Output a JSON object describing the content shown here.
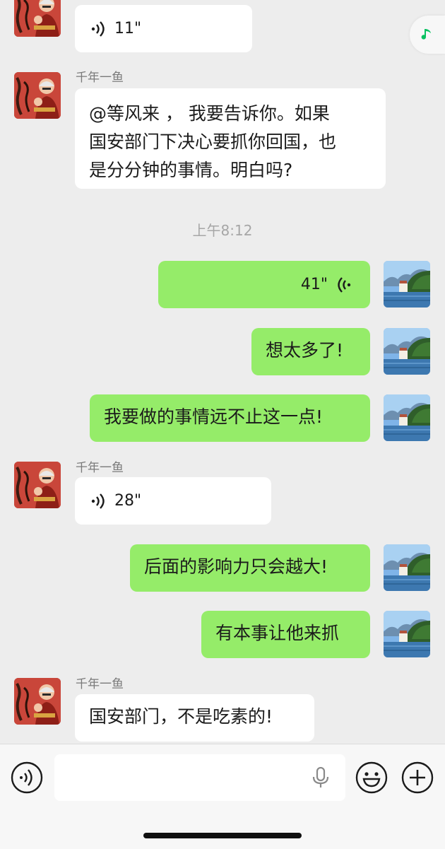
{
  "contact_name": "千年一鱼",
  "timestamp": "上午8:12",
  "messages": [
    {
      "id": "m1",
      "side": "in",
      "type": "voice",
      "duration": "11\""
    },
    {
      "id": "m2",
      "side": "in",
      "type": "text",
      "sender": "千年一鱼",
      "lines": [
        "@等风来 ， 我要告诉你。如果",
        "国安部门下决心要抓你回国，也",
        "是分分钟的事情。明白吗?"
      ]
    },
    {
      "id": "m3",
      "side": "out",
      "type": "voice",
      "duration": "41\""
    },
    {
      "id": "m4",
      "side": "out",
      "type": "text",
      "text": "想太多了!"
    },
    {
      "id": "m5",
      "side": "out",
      "type": "text",
      "text": "我要做的事情远不止这一点!"
    },
    {
      "id": "m6",
      "side": "in",
      "type": "voice",
      "sender": "千年一鱼",
      "duration": "28\""
    },
    {
      "id": "m7",
      "side": "out",
      "type": "text",
      "text": "后面的影响力只会越大!"
    },
    {
      "id": "m8",
      "side": "out",
      "type": "text",
      "text": "有本事让他来抓"
    },
    {
      "id": "m9",
      "side": "in",
      "type": "text",
      "sender": "千年一鱼",
      "text": "国安部门，不是吃素的!"
    }
  ],
  "input": {
    "value": "",
    "placeholder": ""
  },
  "icons": {
    "voice_toggle": "voice-icon",
    "mic": "microphone-icon",
    "emoji": "emoji-icon",
    "plus": "plus-icon",
    "music": "music-note-icon"
  },
  "colors": {
    "background": "#ededed",
    "incoming_bubble": "#ffffff",
    "outgoing_bubble": "#95ec69",
    "music_accent": "#07c160"
  }
}
